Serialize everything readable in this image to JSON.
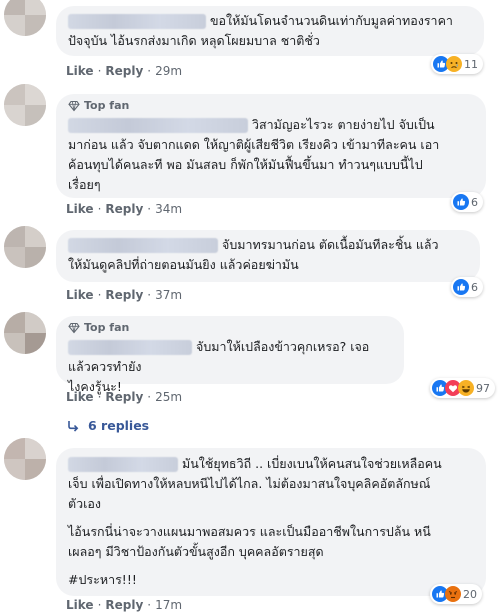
{
  "comments": [
    {
      "line1": "ขอให้มันโดนจำนวนดินเท่ากับมูลค่าทองราคา",
      "line2": "ปัจจุบัน ไอ้นรกส่งมาเกิด หลุดโผยมบาล ชาติชั่ว",
      "like": "Like",
      "reply": "Reply",
      "time": "29m",
      "reaction_count": "11"
    },
    {
      "badge": "Top fan",
      "line1": "วิสามัญอะไรวะ ตายง่ายไป จับเป็น",
      "line2": "มาก่อน แล้ว จับตากแดด ให้ญาติผู้เสียชีวิต เรียงคิว เข้ามาทีละคน เอา",
      "line3": "ค้อนทุบได้คนละที พอ มันสลบ ก็พักให้มันฟื้นขึ้นมา ทำวนๆแบบนี้ไป",
      "line4": "เรื่อยๆ",
      "like": "Like",
      "reply": "Reply",
      "time": "34m",
      "reaction_count": "6"
    },
    {
      "line1": "จับมาทรมานก่อน ตัดเนื้อมันทีละชิ้น แล้ว",
      "line2": "ให้มันดูคลิปที่ถ่ายตอนมันยิง แล้วค่อยฆ่ามัน",
      "like": "Like",
      "reply": "Reply",
      "time": "37m",
      "reaction_count": "6"
    },
    {
      "badge": "Top fan",
      "line1": "จับมาให้เปลืองข้าวคุกเหรอ? เจอแล้วควรทำยัง",
      "line2": "ไงคงรู้นะ!",
      "like": "Like",
      "reply": "Reply",
      "time": "25m",
      "reaction_count": "97",
      "replies_label": "6 replies"
    },
    {
      "line1": "มันใช้ยุทธวิถี .. เบี่ยงเบนให้คนสนใจช่วยเหลือคน",
      "line2": "เจ็บ เพื่อเปิดทางให้หลบหนีไปได้ไกล. ไม่ต้องมาสนใจบุคลิคอัตลักษณ์",
      "line3": "ตัวเอง",
      "line4": "ไอ้นรกนี่น่าจะวางแผนมาพอสมควร และเป็นมืออาชีพในการปล้น หนี",
      "line5": "เผลอๆ มีวิชาป้องกันตัวขั้นสูงอีก บุคคลอัตรายสุด",
      "line6": "#ประหาร!!!",
      "like": "Like",
      "reply": "Reply",
      "time": "17m",
      "reaction_count": "20"
    }
  ],
  "colors": {
    "like_blue": "#1877f2",
    "haha_yellow": "#f7b125",
    "love_red": "#f33e58",
    "angry_orange": "#e9710f",
    "link_blue": "#385898"
  }
}
